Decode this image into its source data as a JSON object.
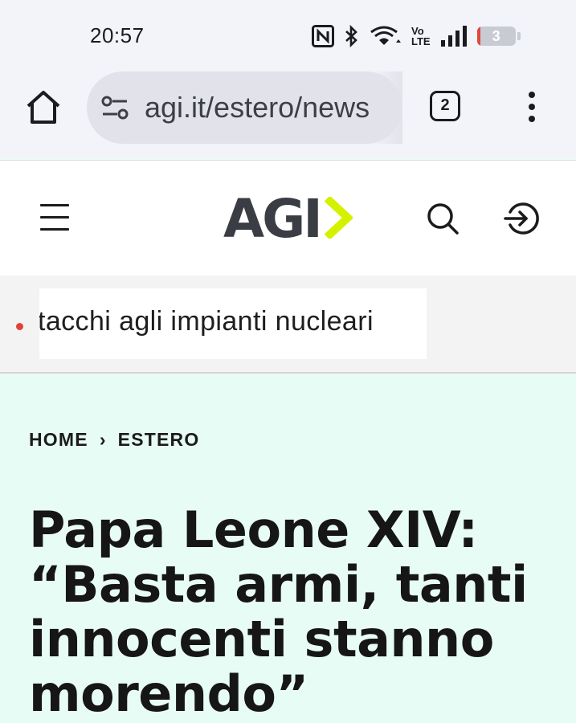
{
  "status_bar": {
    "time": "20:57",
    "icons": [
      "nfc-icon",
      "bluetooth-icon",
      "wifi-icon",
      "volte-icon",
      "signal-icon",
      "battery-icon"
    ],
    "volte_label_top": "Vo",
    "volte_label_bottom": "LTE",
    "battery_level": "3"
  },
  "browser": {
    "url": "agi.it/estero/news",
    "tab_count": "2"
  },
  "site": {
    "logo_text": "AGI",
    "accent_color": "#d4f200"
  },
  "ticker": {
    "text": "tacchi agli impianti nucleari"
  },
  "article": {
    "breadcrumb": {
      "home": "HOME",
      "separator": "›",
      "section": "ESTERO"
    },
    "headline": "Papa Leone XIV: “Basta armi, tanti innocenti stanno morendo”"
  }
}
